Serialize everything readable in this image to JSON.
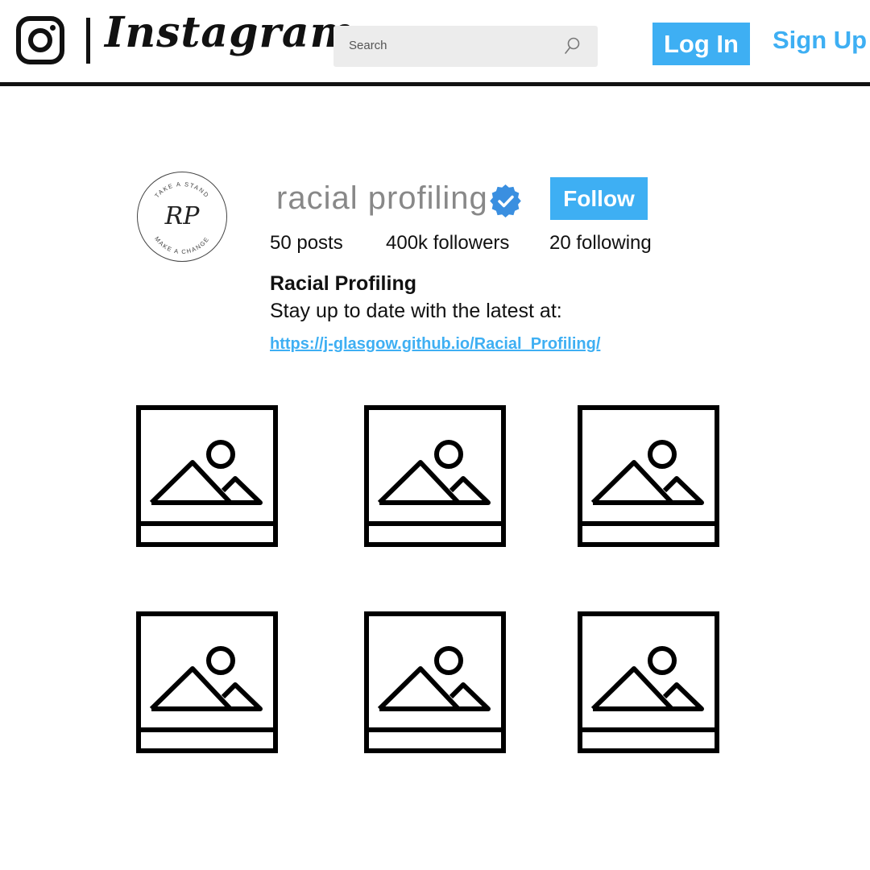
{
  "header": {
    "brand_icon": "instagram-camera-icon",
    "wordmark": "Instagram",
    "search": {
      "placeholder": "Search",
      "icon": "search-icon"
    },
    "login_label": "Log In",
    "signup_label": "Sign Up",
    "accent_color": "#3eaff3"
  },
  "profile": {
    "avatar": {
      "top_text": "TAKE A STAND",
      "monogram": "RP",
      "bottom_text": "MAKE A CHANGE"
    },
    "username": "racial profiling",
    "verified_icon": "verified-badge-icon",
    "follow_label": "Follow",
    "stats": {
      "posts": "50 posts",
      "followers": "400k followers",
      "following": "20 following"
    },
    "display_name": "Racial Profiling",
    "bio": "Stay up to date with the latest at:",
    "link": "https://j-glasgow.github.io/Racial_Profiling/"
  },
  "posts": [
    {
      "icon": "image-placeholder-icon"
    },
    {
      "icon": "image-placeholder-icon"
    },
    {
      "icon": "image-placeholder-icon"
    },
    {
      "icon": "image-placeholder-icon"
    },
    {
      "icon": "image-placeholder-icon"
    },
    {
      "icon": "image-placeholder-icon"
    }
  ]
}
